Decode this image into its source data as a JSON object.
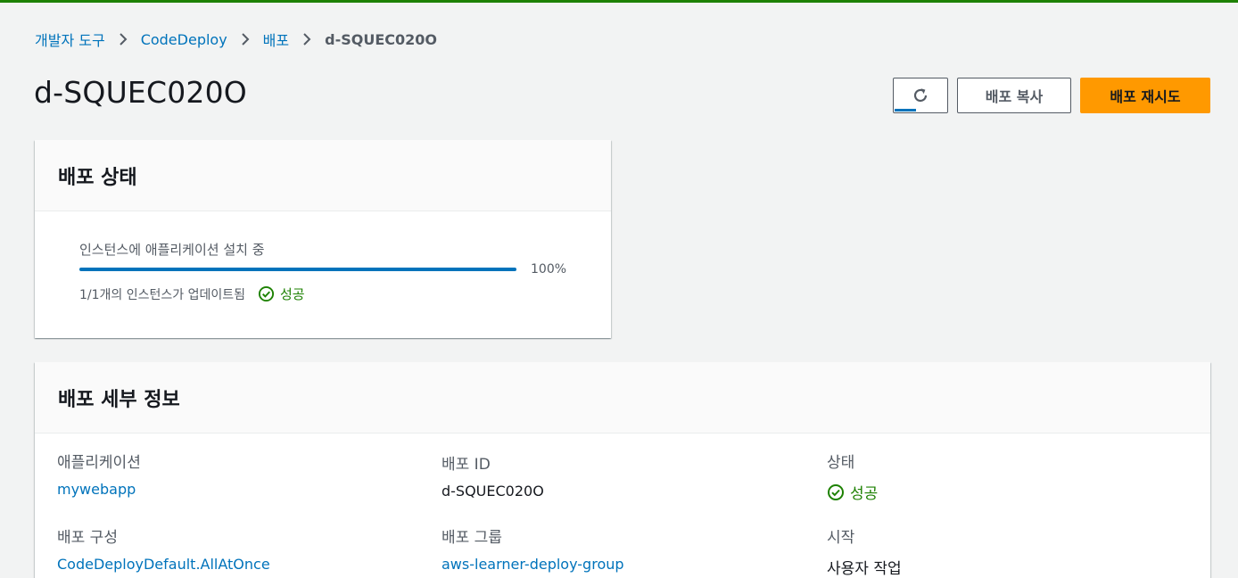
{
  "breadcrumb": {
    "items": [
      "개발자 도구",
      "CodeDeploy",
      "배포"
    ],
    "current": "d-SQUEC020O"
  },
  "page": {
    "title": "d-SQUEC020O"
  },
  "actions": {
    "refresh_icon": "refresh-icon",
    "copy_label": "배포 복사",
    "retry_label": "배포 재시도"
  },
  "status_panel": {
    "title": "배포 상태",
    "progress_label": "인스턴스에 애플리케이션 설치 중",
    "progress_percent": 100,
    "progress_text": "100%",
    "instances_text": "1/1개의 인스턴스가 업데이트됨",
    "result": "성공"
  },
  "details_panel": {
    "title": "배포 세부 정보",
    "fields": [
      {
        "label": "애플리케이션",
        "value": "mywebapp"
      },
      {
        "label": "배포 ID",
        "value": "d-SQUEC020O"
      },
      {
        "label": "상태",
        "value": "성공"
      },
      {
        "label": "배포 구성",
        "value": "CodeDeployDefault.AllAtOnce"
      },
      {
        "label": "배포 그룹",
        "value": "aws-learner-deploy-group"
      },
      {
        "label": "시작",
        "value": "사용자 작업"
      }
    ]
  },
  "colors": {
    "accent": "#0073bb",
    "success": "#1d8102",
    "primary_button": "#ff9900"
  }
}
